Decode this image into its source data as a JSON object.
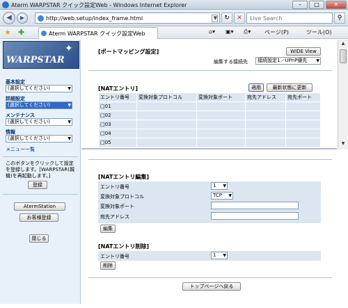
{
  "window": {
    "title": "Aterm WARPSTAR クイック設定Web - Windows Internet Explorer",
    "minimize": "–",
    "maximize": "□",
    "close": "✕"
  },
  "address": {
    "url": "http://web.setup/index_frame.html",
    "search_placeholder": "Live Search"
  },
  "tab": {
    "label": "Aterm WARPSTAR クイック設定Web"
  },
  "commands": {
    "page": "ページ(P)",
    "tools": "ツール(O)"
  },
  "sidebar": {
    "logo": "WARPSTAR",
    "basic_label": "基本設定",
    "basic_value": "(選択してください)",
    "detail_label": "詳細設定",
    "detail_value": "(選択してください)",
    "maint_label": "メンテナンス",
    "maint_value": "(選択してください)",
    "info_label": "情報",
    "info_value": "(選択してください)",
    "menu_list": "メニュー一覧",
    "note": "このボタンをクリックして設定を登録します。[WARPSTAR(親機)を再起動します。]",
    "register_button": "登録",
    "aterm_station_button": "AtermStation",
    "customer_button": "お客様登録",
    "close_button": "閉じる"
  },
  "upper": {
    "title": "[ポートマッピング設定]",
    "wide_view": "WIDE View",
    "conn_label": "編集する接続先",
    "conn_value": "接続設定1／UPnP優先",
    "nat_title": "[NATエントリ]",
    "apply_button": "適用",
    "refresh_button": "最新状態に更新",
    "columns": [
      "エントリ番号",
      "変換対象プロトコル",
      "変換対象ポート",
      "宛先アドレス",
      "宛先ポート"
    ],
    "rows": [
      "01",
      "02",
      "03",
      "04",
      "05"
    ]
  },
  "lower": {
    "edit_title": "[NATエントリ編集]",
    "entry_label": "エントリ番号",
    "entry_value": "1",
    "protocol_label": "変換対象プロトコル",
    "protocol_value": "TCP",
    "port_label": "変換対象ポート",
    "dest_label": "宛先アドレス",
    "edit_button": "編集",
    "delete_title": "[NATエントリ削除]",
    "delete_entry_label": "エントリ番号",
    "delete_entry_value": "1",
    "delete_button": "削除",
    "top_button": "トップページへ戻る"
  }
}
